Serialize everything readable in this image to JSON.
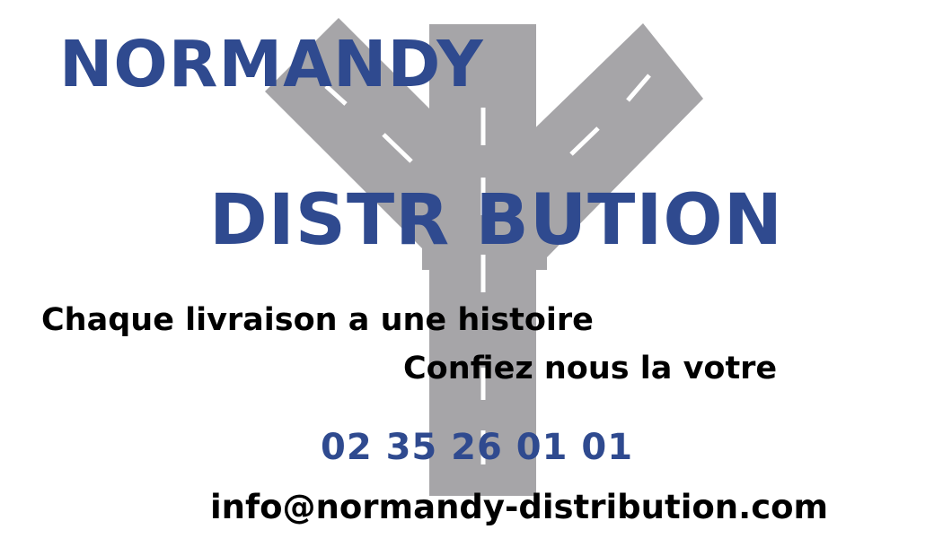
{
  "card": {
    "brand_line_1": "NORMANDY",
    "brand_line_2": "DISTR BUTION",
    "tagline_1": "Chaque livraison a une histoire",
    "tagline_2": "Confiez nous la votre",
    "phone": "02 35 26 01 01",
    "email": "info@normandy-distribution.com"
  },
  "logo": {
    "icon": "y-shaped-road-icon"
  },
  "colors": {
    "brand_blue": "#2f4a8f",
    "road_gray": "#a6a5a8",
    "lane_marking": "#ffffff",
    "text_black": "#000000",
    "background": "#ffffff"
  }
}
